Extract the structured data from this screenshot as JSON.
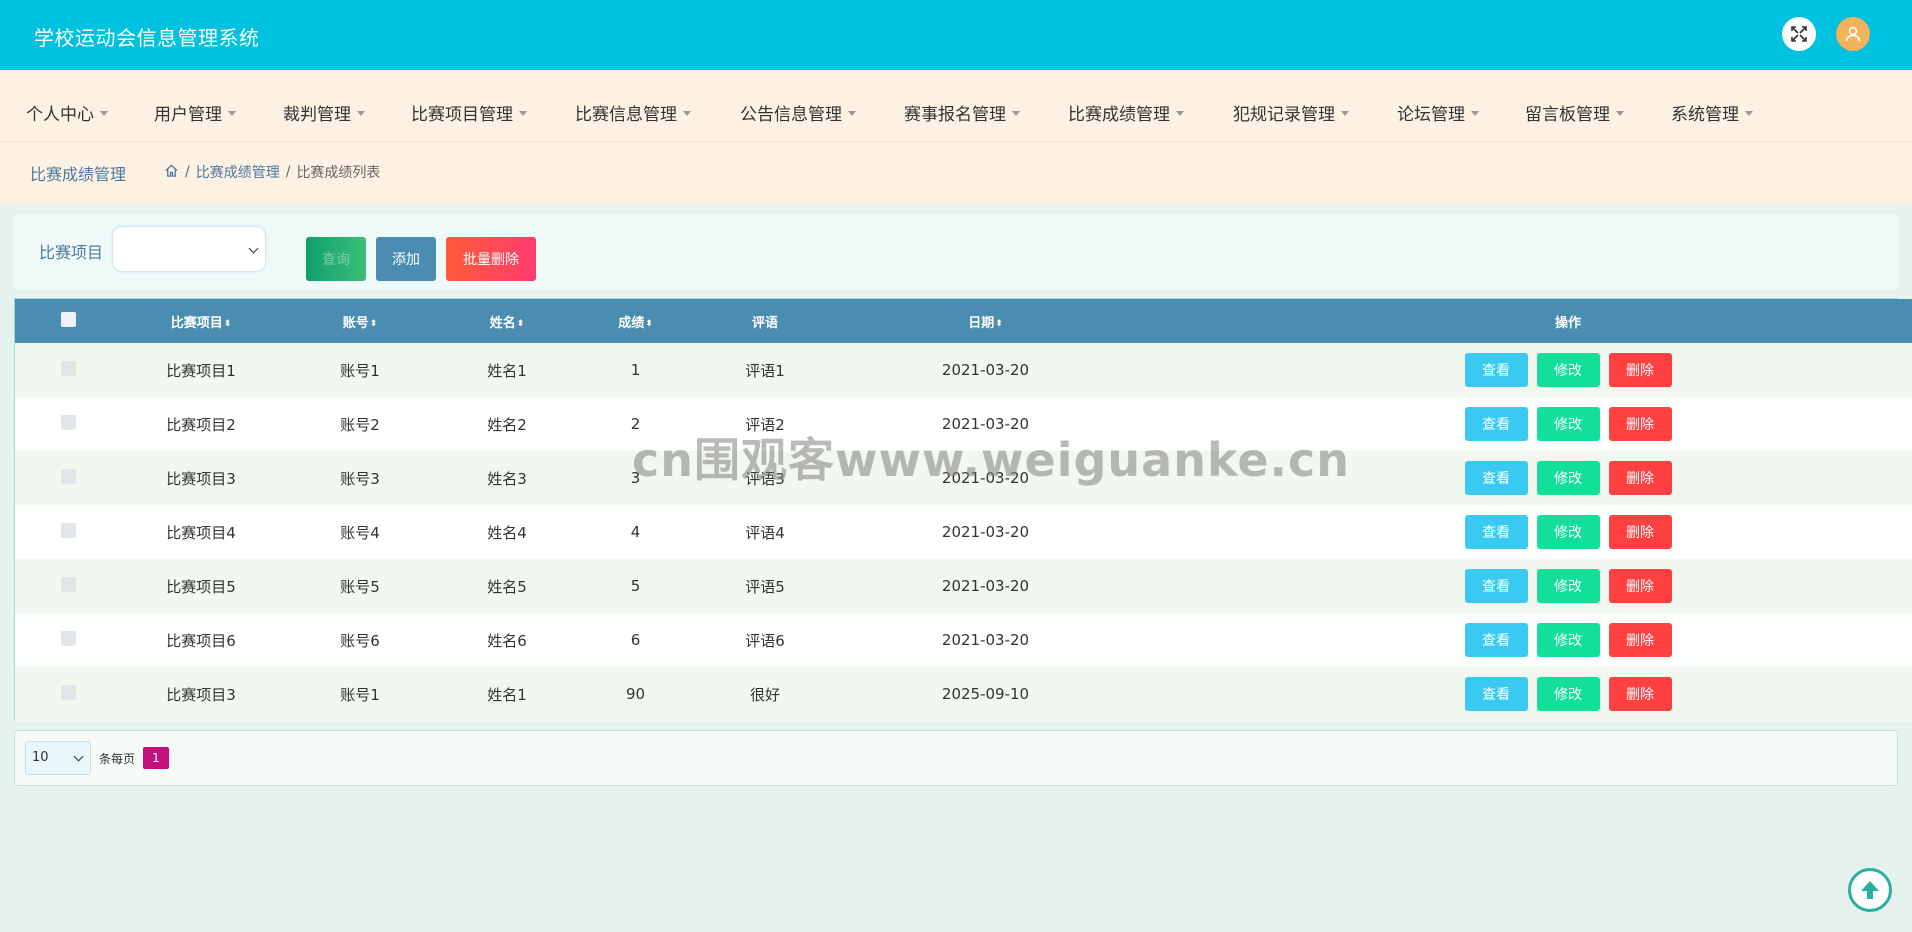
{
  "app": {
    "title": "学校运动会信息管理系统"
  },
  "header_icons": {
    "fullscreen": "fullscreen-icon",
    "avatar": "user-avatar-icon",
    "avatar_color": "#f3b35a"
  },
  "nav": {
    "items": [
      {
        "label": "个人中心"
      },
      {
        "label": "用户管理"
      },
      {
        "label": "裁判管理"
      },
      {
        "label": "比赛项目管理"
      },
      {
        "label": "比赛信息管理"
      },
      {
        "label": "公告信息管理"
      },
      {
        "label": "赛事报名管理"
      },
      {
        "label": "比赛成绩管理"
      },
      {
        "label": "犯规记录管理"
      },
      {
        "label": "论坛管理"
      },
      {
        "label": "留言板管理"
      },
      {
        "label": "系统管理"
      }
    ]
  },
  "breadcrumb": {
    "page_title": "比赛成绩管理",
    "home_icon": "home-icon",
    "level1": "比赛成绩管理",
    "level2": "比赛成绩列表"
  },
  "search": {
    "label": "比赛项目",
    "select_value": "",
    "query_label": "查询",
    "add_label": "添加",
    "batch_delete_label": "批量删除"
  },
  "table": {
    "headers": [
      "比赛项目",
      "账号",
      "姓名",
      "成绩",
      "评语",
      "日期",
      "操作"
    ],
    "sort_glyph": "⬍",
    "actions": {
      "view": "查看",
      "edit": "修改",
      "delete": "删除"
    },
    "rows": [
      [
        "比赛项目1",
        "账号1",
        "姓名1",
        "1",
        "评语1",
        "2021-03-20"
      ],
      [
        "比赛项目2",
        "账号2",
        "姓名2",
        "2",
        "评语2",
        "2021-03-20"
      ],
      [
        "比赛项目3",
        "账号3",
        "姓名3",
        "3",
        "评语3",
        "2021-03-20"
      ],
      [
        "比赛项目4",
        "账号4",
        "姓名4",
        "4",
        "评语4",
        "2021-03-20"
      ],
      [
        "比赛项目5",
        "账号5",
        "姓名5",
        "5",
        "评语5",
        "2021-03-20"
      ],
      [
        "比赛项目6",
        "账号6",
        "姓名6",
        "6",
        "评语6",
        "2021-03-20"
      ],
      [
        "比赛项目3",
        "账号1",
        "姓名1",
        "90",
        "很好",
        "2025-09-10"
      ]
    ]
  },
  "pagination": {
    "page_size": "10",
    "per_page_label": "条每页",
    "current_page": "1"
  },
  "watermark": "cn围观客www.weiguanke.cn",
  "back_to_top_icon": "arrow-up-icon"
}
